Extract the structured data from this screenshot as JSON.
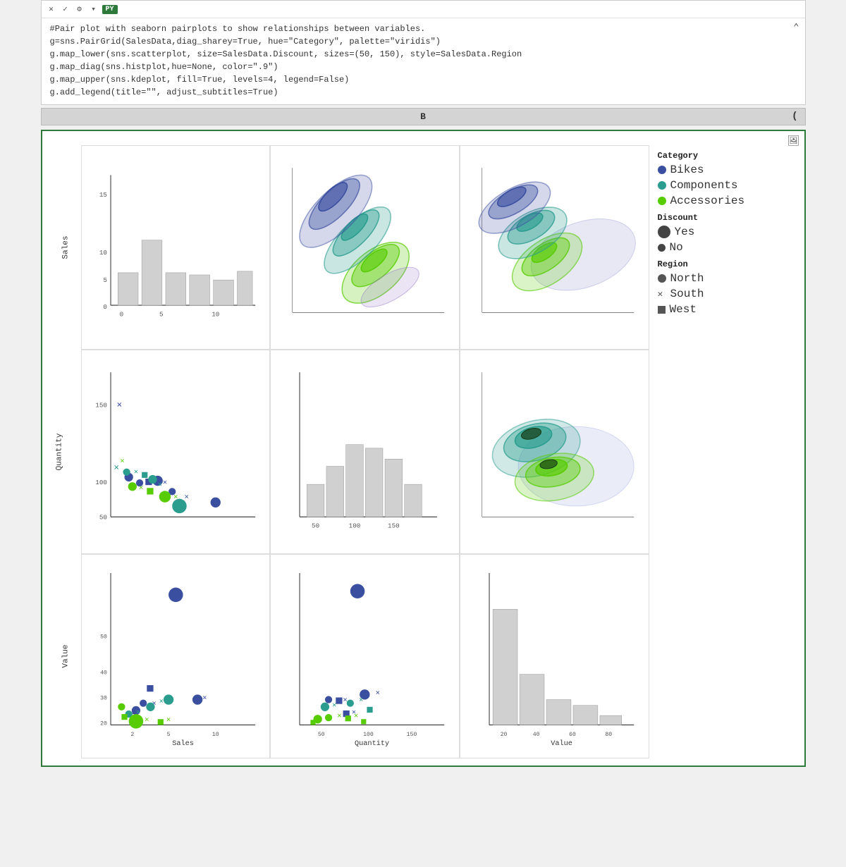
{
  "toolbar": {
    "py_label": "PY",
    "close_icon": "✕",
    "check_icon": "✓",
    "expand_icon": "⊞"
  },
  "code": {
    "line1": "#Pair plot with seaborn pairplots to show relationships between variables.",
    "line2": "g=sns.PairGrid(SalesData,diag_sharey=True, hue=\"Category\", palette=\"viridis\")",
    "line3": "g.map_lower(sns.scatterplot, size=SalesData.Discount, sizes=(50, 150), style=SalesData.Region",
    "line4": "g.map_diag(sns.histplot,hue=None, color=\".9\")",
    "line5": "g.map_upper(sns.kdeplot, fill=True, levels=4, legend=False)",
    "line6": "g.add_legend(title=\"\", adjust_subtitles=True)"
  },
  "section_b": {
    "label": "B"
  },
  "legend": {
    "category_title": "Category",
    "items": [
      {
        "label": "Bikes",
        "color": "#3b4fa0"
      },
      {
        "label": "Components",
        "color": "#2a9d8f"
      },
      {
        "label": "Accessories",
        "color": "#57cc02"
      }
    ],
    "discount_title": "Discount",
    "discount_items": [
      {
        "label": "Yes",
        "size": "large"
      },
      {
        "label": "No",
        "size": "small"
      }
    ],
    "region_title": "Region",
    "region_items": [
      {
        "label": "North",
        "shape": "circle"
      },
      {
        "label": "South",
        "shape": "x"
      },
      {
        "label": "West",
        "shape": "square"
      }
    ]
  },
  "axes": {
    "row_labels": [
      "Sales",
      "Quantity",
      "Value"
    ],
    "col_labels": [
      "Sales",
      "Quantity",
      "Value"
    ],
    "sales_yticks": [
      "15",
      "10",
      "5",
      "0"
    ],
    "quantity_yticks": [
      "150",
      "100",
      "50"
    ],
    "value_yticks": [
      "50",
      "40",
      "30",
      "20"
    ],
    "sales_xticks": [
      "0",
      "5",
      "10"
    ],
    "quantity_xticks": [
      "50",
      "100",
      "150"
    ],
    "value_xticks": [
      "20",
      "40",
      "60",
      "80"
    ]
  }
}
